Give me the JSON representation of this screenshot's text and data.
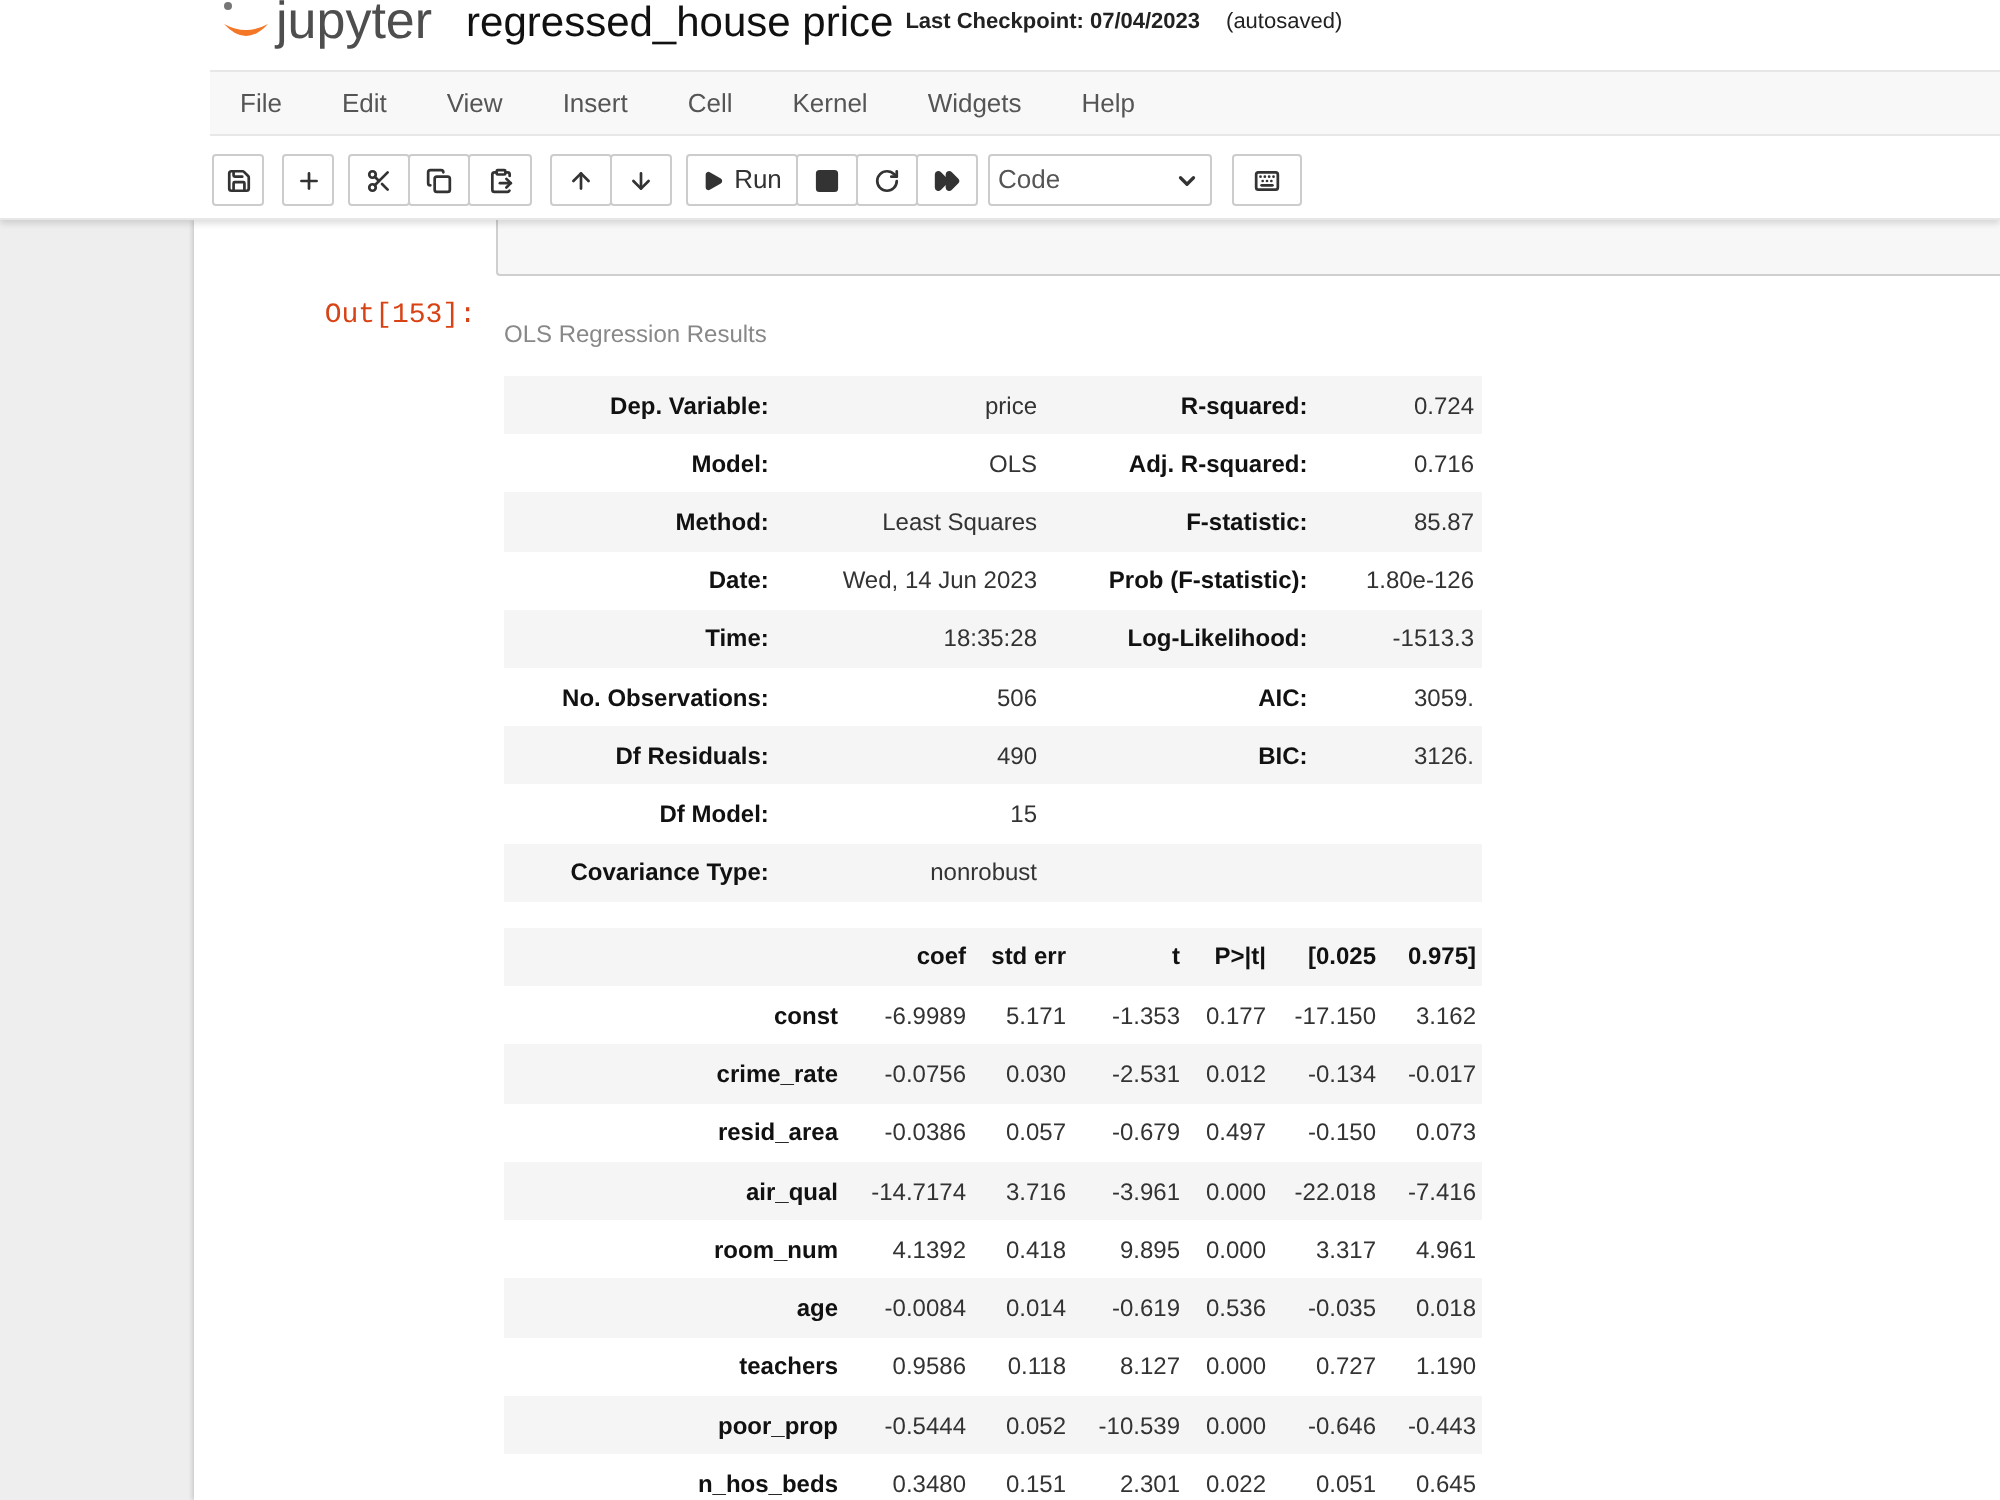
{
  "header": {
    "logo_text": "jupyter",
    "notebook_name": "regressed_house price",
    "checkpoint": "Last Checkpoint: 07/04/2023",
    "save_status": "(autosaved)"
  },
  "menu": [
    "File",
    "Edit",
    "View",
    "Insert",
    "Cell",
    "Kernel",
    "Widgets",
    "Help"
  ],
  "toolbar": {
    "run_label": "Run",
    "cell_type": "Code"
  },
  "output": {
    "prompt": "Out[153]:",
    "caption": "OLS Regression Results",
    "summary_rows": [
      [
        "Dep. Variable:",
        "price",
        "R-squared:",
        "0.724"
      ],
      [
        "Model:",
        "OLS",
        "Adj. R-squared:",
        "0.716"
      ],
      [
        "Method:",
        "Least Squares",
        "F-statistic:",
        "85.87"
      ],
      [
        "Date:",
        "Wed, 14 Jun 2023",
        "Prob (F-statistic):",
        "1.80e-126"
      ],
      [
        "Time:",
        "18:35:28",
        "Log-Likelihood:",
        "-1513.3"
      ],
      [
        "No. Observations:",
        "506",
        "AIC:",
        "3059."
      ],
      [
        "Df Residuals:",
        "490",
        "BIC:",
        "3126."
      ],
      [
        "Df Model:",
        "15"
      ],
      [
        "Covariance Type:",
        "nonrobust"
      ]
    ],
    "coef_columns": [
      "coef",
      "std err",
      "t",
      "P>|t|",
      "[0.025",
      "0.975]"
    ],
    "coef_rows": [
      {
        "name": "const",
        "values": [
          "-6.9989",
          "5.171",
          "-1.353",
          "0.177",
          "-17.150",
          "3.162"
        ]
      },
      {
        "name": "crime_rate",
        "values": [
          "-0.0756",
          "0.030",
          "-2.531",
          "0.012",
          "-0.134",
          "-0.017"
        ]
      },
      {
        "name": "resid_area",
        "values": [
          "-0.0386",
          "0.057",
          "-0.679",
          "0.497",
          "-0.150",
          "0.073"
        ]
      },
      {
        "name": "air_qual",
        "values": [
          "-14.7174",
          "3.716",
          "-3.961",
          "0.000",
          "-22.018",
          "-7.416"
        ]
      },
      {
        "name": "room_num",
        "values": [
          "4.1392",
          "0.418",
          "9.895",
          "0.000",
          "3.317",
          "4.961"
        ]
      },
      {
        "name": "age",
        "values": [
          "-0.0084",
          "0.014",
          "-0.619",
          "0.536",
          "-0.035",
          "0.018"
        ]
      },
      {
        "name": "teachers",
        "values": [
          "0.9586",
          "0.118",
          "8.127",
          "0.000",
          "0.727",
          "1.190"
        ]
      },
      {
        "name": "poor_prop",
        "values": [
          "-0.5444",
          "0.052",
          "-10.539",
          "0.000",
          "-0.646",
          "-0.443"
        ]
      },
      {
        "name": "n_hos_beds",
        "values": [
          "0.3480",
          "0.151",
          "2.301",
          "0.022",
          "0.051",
          "0.645"
        ]
      }
    ]
  }
}
